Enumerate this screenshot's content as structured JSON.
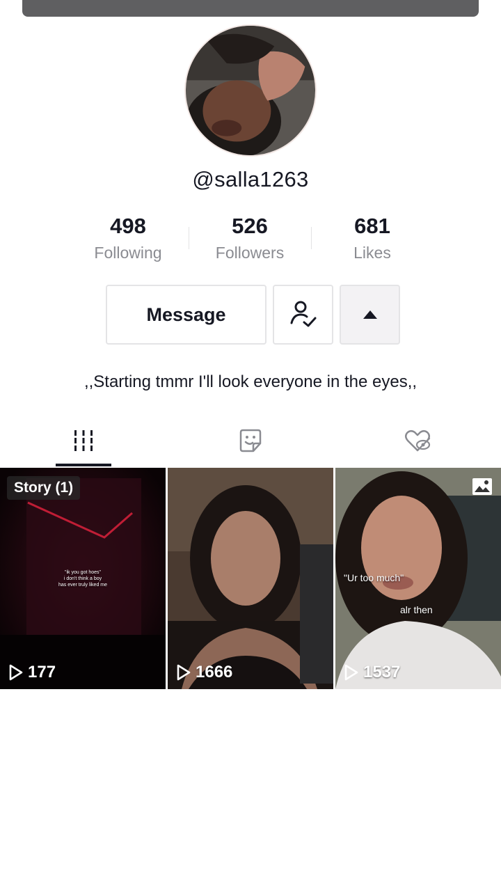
{
  "profile": {
    "username": "@salla1263",
    "bio": ",,Starting tmmr I'll look everyone in the eyes,,"
  },
  "stats": {
    "following": {
      "count": "498",
      "label": "Following"
    },
    "followers": {
      "count": "526",
      "label": "Followers"
    },
    "likes": {
      "count": "681",
      "label": "Likes"
    }
  },
  "actions": {
    "message_label": "Message",
    "follow_icon": "user-check-icon",
    "more_icon": "caret-up-icon"
  },
  "tabs": [
    {
      "icon": "grid-icon",
      "selected": true
    },
    {
      "icon": "sticker-icon",
      "selected": false
    },
    {
      "icon": "liked-hidden-icon",
      "selected": false
    }
  ],
  "videos": [
    {
      "badge": "Story (1)",
      "views": "177",
      "caption_lines": [
        "\"ik you got hoes\"",
        "i don't think a boy",
        "has ever truly liked me"
      ]
    },
    {
      "views": "1666"
    },
    {
      "views": "1537",
      "caption_top": "\"Ur too much\"",
      "caption_bottom": "alr then",
      "photo_icon": "photo-icon"
    }
  ],
  "colors": {
    "text_primary": "#161823",
    "text_secondary": "#8a8b91",
    "border": "#e4e4e6"
  }
}
